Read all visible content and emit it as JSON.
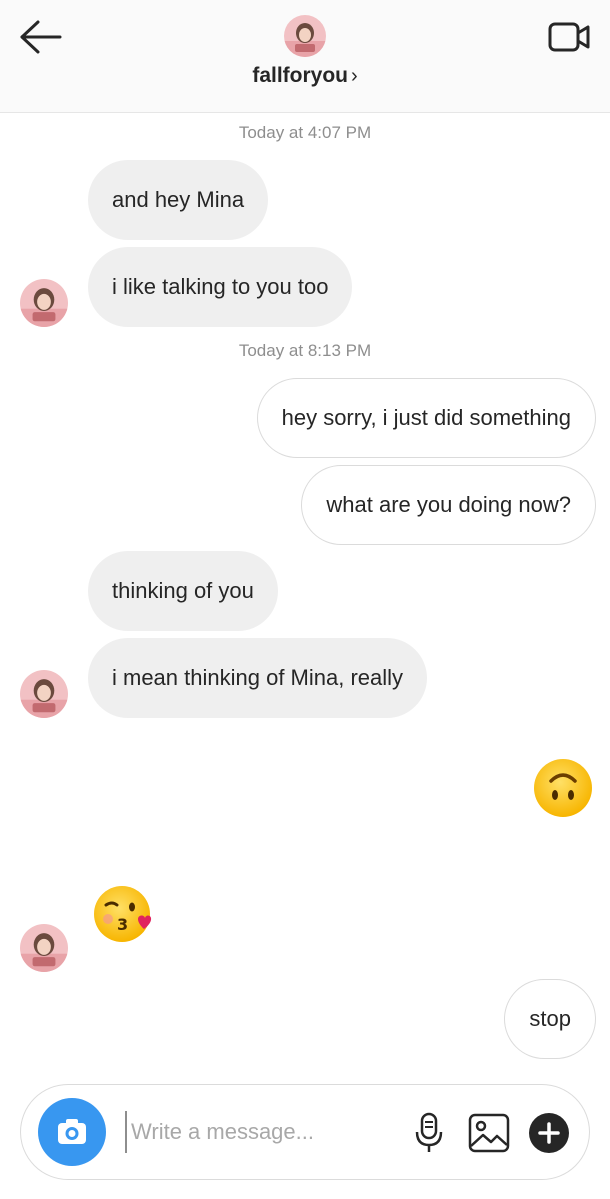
{
  "header": {
    "username": "fallforyou",
    "chevron": "›",
    "back_icon": "arrow-left-icon",
    "video_icon": "video-camera-icon"
  },
  "thread": {
    "timestamps": [
      "Today at 4:07 PM",
      "Today at 8:13 PM"
    ],
    "messages": [
      {
        "from": "them",
        "text": "and hey Mina"
      },
      {
        "from": "them",
        "text": "i like talking to you too"
      },
      {
        "from": "me",
        "text": "hey sorry, i just did something"
      },
      {
        "from": "me",
        "text": "what are you doing now?"
      },
      {
        "from": "them",
        "text": "thinking of you"
      },
      {
        "from": "them",
        "text": "i mean thinking of Mina, really"
      },
      {
        "from": "me",
        "emoji": "upside-down-face"
      },
      {
        "from": "them",
        "emoji": "face-blowing-kiss"
      },
      {
        "from": "me",
        "text": "stop"
      }
    ]
  },
  "composer": {
    "placeholder": "Write a message...",
    "value": "",
    "camera_icon": "camera-icon",
    "mic_icon": "microphone-icon",
    "gallery_icon": "image-icon",
    "more_icon": "plus-icon"
  },
  "colors": {
    "accent": "#3897f0",
    "incoming_bubble": "#efefef",
    "outgoing_border": "#dbdbdb",
    "timestamp": "#8e8e8e"
  }
}
